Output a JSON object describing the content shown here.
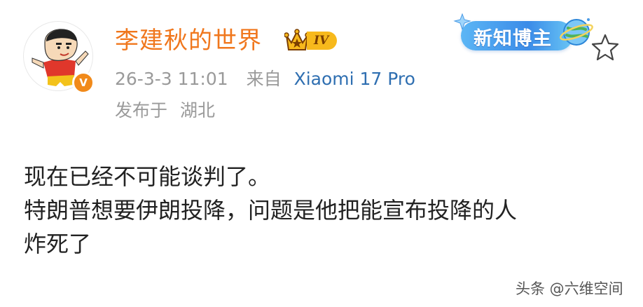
{
  "post": {
    "author_name": "李建秋的世界",
    "level": "IV",
    "timestamp": "26-3-3 11:01",
    "source_prefix": "来自",
    "device": "Xiaomi 17 Pro",
    "location_prefix": "发布于",
    "location": "湖北",
    "badge_label": "新知博主",
    "verified_mark": "V",
    "content_lines": [
      "现在已经不可能谈判了。",
      "特朗普想要伊朗投降，问题是他把能宣布投降的人",
      "炸死了"
    ]
  },
  "watermark": "头条 @六维空间",
  "colors": {
    "author": "#f0771d",
    "meta": "#9a9a9a",
    "device": "#2f6fb1",
    "content": "#222222",
    "level_badge": "#f7b91c",
    "new_badge": "#3a8be8"
  },
  "icons": {
    "avatar": "cartoon-avatar",
    "crown": "crown-icon",
    "globe": "globe-icon",
    "favorite": "star-outline-icon"
  }
}
